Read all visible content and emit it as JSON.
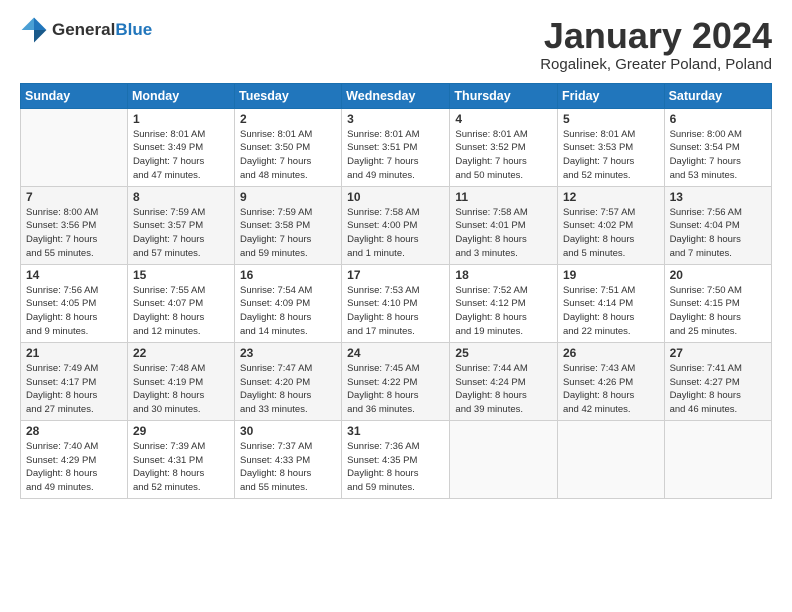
{
  "header": {
    "logo": {
      "general": "General",
      "blue": "Blue"
    },
    "title": "January 2024",
    "location": "Rogalinek, Greater Poland, Poland"
  },
  "calendar": {
    "days_of_week": [
      "Sunday",
      "Monday",
      "Tuesday",
      "Wednesday",
      "Thursday",
      "Friday",
      "Saturday"
    ],
    "weeks": [
      [
        {
          "day": "",
          "info": ""
        },
        {
          "day": "1",
          "info": "Sunrise: 8:01 AM\nSunset: 3:49 PM\nDaylight: 7 hours\nand 47 minutes."
        },
        {
          "day": "2",
          "info": "Sunrise: 8:01 AM\nSunset: 3:50 PM\nDaylight: 7 hours\nand 48 minutes."
        },
        {
          "day": "3",
          "info": "Sunrise: 8:01 AM\nSunset: 3:51 PM\nDaylight: 7 hours\nand 49 minutes."
        },
        {
          "day": "4",
          "info": "Sunrise: 8:01 AM\nSunset: 3:52 PM\nDaylight: 7 hours\nand 50 minutes."
        },
        {
          "day": "5",
          "info": "Sunrise: 8:01 AM\nSunset: 3:53 PM\nDaylight: 7 hours\nand 52 minutes."
        },
        {
          "day": "6",
          "info": "Sunrise: 8:00 AM\nSunset: 3:54 PM\nDaylight: 7 hours\nand 53 minutes."
        }
      ],
      [
        {
          "day": "7",
          "info": "Sunrise: 8:00 AM\nSunset: 3:56 PM\nDaylight: 7 hours\nand 55 minutes."
        },
        {
          "day": "8",
          "info": "Sunrise: 7:59 AM\nSunset: 3:57 PM\nDaylight: 7 hours\nand 57 minutes."
        },
        {
          "day": "9",
          "info": "Sunrise: 7:59 AM\nSunset: 3:58 PM\nDaylight: 7 hours\nand 59 minutes."
        },
        {
          "day": "10",
          "info": "Sunrise: 7:58 AM\nSunset: 4:00 PM\nDaylight: 8 hours\nand 1 minute."
        },
        {
          "day": "11",
          "info": "Sunrise: 7:58 AM\nSunset: 4:01 PM\nDaylight: 8 hours\nand 3 minutes."
        },
        {
          "day": "12",
          "info": "Sunrise: 7:57 AM\nSunset: 4:02 PM\nDaylight: 8 hours\nand 5 minutes."
        },
        {
          "day": "13",
          "info": "Sunrise: 7:56 AM\nSunset: 4:04 PM\nDaylight: 8 hours\nand 7 minutes."
        }
      ],
      [
        {
          "day": "14",
          "info": "Sunrise: 7:56 AM\nSunset: 4:05 PM\nDaylight: 8 hours\nand 9 minutes."
        },
        {
          "day": "15",
          "info": "Sunrise: 7:55 AM\nSunset: 4:07 PM\nDaylight: 8 hours\nand 12 minutes."
        },
        {
          "day": "16",
          "info": "Sunrise: 7:54 AM\nSunset: 4:09 PM\nDaylight: 8 hours\nand 14 minutes."
        },
        {
          "day": "17",
          "info": "Sunrise: 7:53 AM\nSunset: 4:10 PM\nDaylight: 8 hours\nand 17 minutes."
        },
        {
          "day": "18",
          "info": "Sunrise: 7:52 AM\nSunset: 4:12 PM\nDaylight: 8 hours\nand 19 minutes."
        },
        {
          "day": "19",
          "info": "Sunrise: 7:51 AM\nSunset: 4:14 PM\nDaylight: 8 hours\nand 22 minutes."
        },
        {
          "day": "20",
          "info": "Sunrise: 7:50 AM\nSunset: 4:15 PM\nDaylight: 8 hours\nand 25 minutes."
        }
      ],
      [
        {
          "day": "21",
          "info": "Sunrise: 7:49 AM\nSunset: 4:17 PM\nDaylight: 8 hours\nand 27 minutes."
        },
        {
          "day": "22",
          "info": "Sunrise: 7:48 AM\nSunset: 4:19 PM\nDaylight: 8 hours\nand 30 minutes."
        },
        {
          "day": "23",
          "info": "Sunrise: 7:47 AM\nSunset: 4:20 PM\nDaylight: 8 hours\nand 33 minutes."
        },
        {
          "day": "24",
          "info": "Sunrise: 7:45 AM\nSunset: 4:22 PM\nDaylight: 8 hours\nand 36 minutes."
        },
        {
          "day": "25",
          "info": "Sunrise: 7:44 AM\nSunset: 4:24 PM\nDaylight: 8 hours\nand 39 minutes."
        },
        {
          "day": "26",
          "info": "Sunrise: 7:43 AM\nSunset: 4:26 PM\nDaylight: 8 hours\nand 42 minutes."
        },
        {
          "day": "27",
          "info": "Sunrise: 7:41 AM\nSunset: 4:27 PM\nDaylight: 8 hours\nand 46 minutes."
        }
      ],
      [
        {
          "day": "28",
          "info": "Sunrise: 7:40 AM\nSunset: 4:29 PM\nDaylight: 8 hours\nand 49 minutes."
        },
        {
          "day": "29",
          "info": "Sunrise: 7:39 AM\nSunset: 4:31 PM\nDaylight: 8 hours\nand 52 minutes."
        },
        {
          "day": "30",
          "info": "Sunrise: 7:37 AM\nSunset: 4:33 PM\nDaylight: 8 hours\nand 55 minutes."
        },
        {
          "day": "31",
          "info": "Sunrise: 7:36 AM\nSunset: 4:35 PM\nDaylight: 8 hours\nand 59 minutes."
        },
        {
          "day": "",
          "info": ""
        },
        {
          "day": "",
          "info": ""
        },
        {
          "day": "",
          "info": ""
        }
      ]
    ]
  }
}
